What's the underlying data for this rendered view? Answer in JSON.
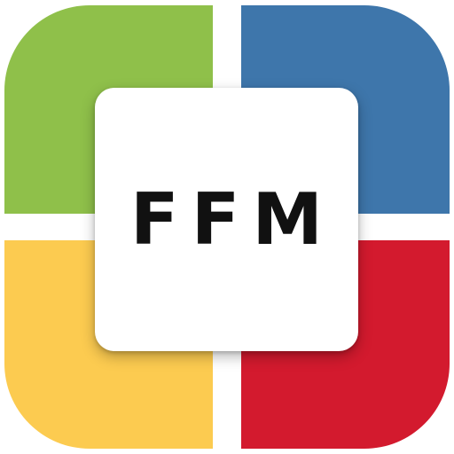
{
  "logo": {
    "text": "FFM"
  },
  "colors": {
    "top_left": "#8fc04a",
    "top_right": "#3e76ab",
    "bottom_left": "#fccb50",
    "bottom_right": "#d31a2e",
    "tile": "#ffffff",
    "text": "#111111"
  }
}
